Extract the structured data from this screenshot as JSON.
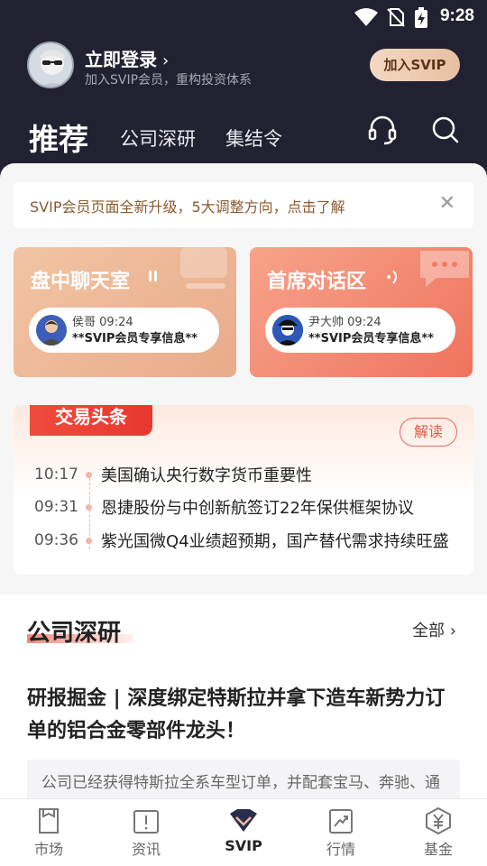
{
  "status_bar": {
    "time": "9:28",
    "icons": [
      "wifi-icon",
      "no-sim-icon",
      "battery-charging-icon"
    ]
  },
  "profile": {
    "login_label": "立即登录",
    "subtitle": "加入SVIP会员，重构投资体系",
    "join_button": "加入SVIP"
  },
  "tabs": [
    {
      "label": "推荐",
      "active": true
    },
    {
      "label": "公司深研"
    },
    {
      "label": "集结令"
    }
  ],
  "notice": {
    "text": "SVIP会员页面全新升级，5大调整方向，点击了解"
  },
  "rooms": [
    {
      "title": "盘中聊天室",
      "user": "侯哥",
      "time": "09:24",
      "message": "**SVIP会员专享信息**"
    },
    {
      "title": "首席对话区",
      "user": "尹大帅",
      "time": "09:24",
      "message": "**SVIP会员专享信息**"
    }
  ],
  "headline": {
    "tag": "交易头条",
    "read_button": "解读",
    "items": [
      {
        "time": "10:17",
        "title": "美国确认央行数字货币重要性"
      },
      {
        "time": "09:31",
        "title": "恩捷股份与中创新航签订22年保供框架协议"
      },
      {
        "time": "09:36",
        "title": "紫光国微Q4业绩超预期，国产替代需求持续旺盛"
      }
    ]
  },
  "research": {
    "title": "公司深研",
    "all_link": "全部",
    "article_title": "研报掘金 | 深度绑定特斯拉并拿下造车新势力订单的铝合金零部件龙头！",
    "summary": "公司已经获得特斯拉全系车型订单，并配套宝马、奔驰、通用等全球主流主机厂。"
  },
  "bottom_nav": [
    {
      "label": "市场",
      "icon": "market-icon"
    },
    {
      "label": "资讯",
      "icon": "news-icon"
    },
    {
      "label": "SVIP",
      "icon": "svip-icon",
      "active": true
    },
    {
      "label": "行情",
      "icon": "quotes-icon"
    },
    {
      "label": "基金",
      "icon": "fund-icon"
    }
  ],
  "colors": {
    "header_bg": "#222131",
    "accent_red": "#e8382f",
    "gold": "#e8bfa0"
  }
}
